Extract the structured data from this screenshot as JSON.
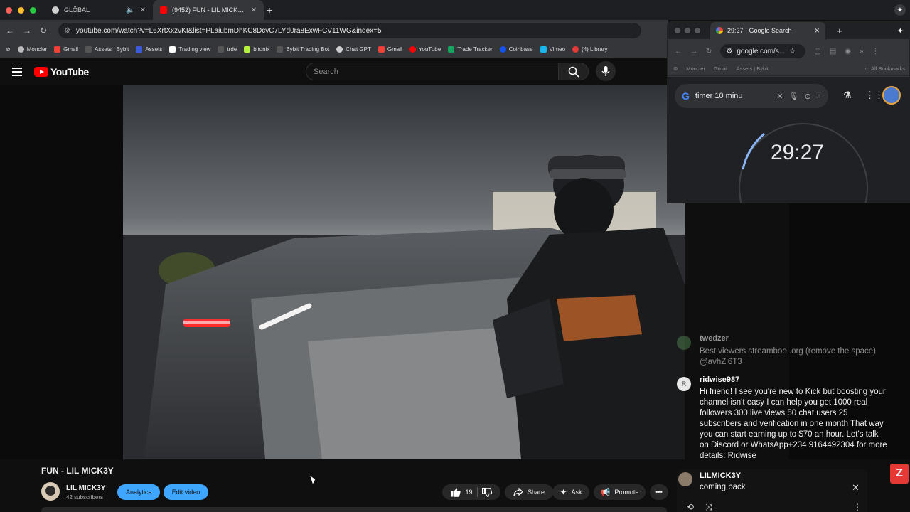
{
  "browser": {
    "tabs": [
      {
        "title": "GLÖBAL",
        "active": false
      },
      {
        "title": "(9452) FUN - LIL MICK3Y - Y",
        "active": true
      }
    ],
    "new_tab": "+",
    "url": "youtube.com/watch?v=L6XrtXxzvKI&list=PLaiubmDhKC8DcvC7LYd0ra8ExwFCV11WG&index=5",
    "bookmarks": [
      {
        "label": "Moncler",
        "color": "#bbbbbb"
      },
      {
        "label": "Gmail",
        "color": "#ea4335"
      },
      {
        "label": "Assets | Bybit",
        "color": "#555555"
      },
      {
        "label": "Assets",
        "color": "#3b5bdb"
      },
      {
        "label": "Trading view",
        "color": "#ffffff"
      },
      {
        "label": "trde",
        "color": "#555555"
      },
      {
        "label": "bitunix",
        "color": "#b5f23c"
      },
      {
        "label": "Bybit Trading Bot",
        "color": "#555555"
      },
      {
        "label": "Chat GPT",
        "color": "#cccccc"
      },
      {
        "label": "Gmail",
        "color": "#ea4335"
      },
      {
        "label": "YouTube",
        "color": "#ff0000"
      },
      {
        "label": "Trade Tracker",
        "color": "#1aa260"
      },
      {
        "label": "Coinbase",
        "color": "#1652f0"
      },
      {
        "label": "Vimeo",
        "color": "#1ab7ea"
      },
      {
        "label": "(4) Library",
        "color": "#e53935"
      }
    ]
  },
  "youtube": {
    "logo_text": "YouTube",
    "search_placeholder": "Search",
    "video_title": "FUN - LIL MICK3Y",
    "channel_name": "LIL MICK3Y",
    "subscribers": "42 subscribers",
    "analytics_label": "Analytics",
    "edit_video_label": "Edit video",
    "like_count": "19",
    "share_label": "Share",
    "ask_label": "Ask",
    "promote_label": "Promote",
    "more_label": "•••"
  },
  "google_window": {
    "tab_title": "29:27 - Google Search",
    "url": "google.com/s...",
    "bookmarks": [
      "Moncler",
      "Gmail",
      "Assets | Bybit"
    ],
    "all_bookmarks": "All Bookmarks",
    "search_query": "timer 10 minu",
    "timer": "29:27"
  },
  "chat": {
    "messages": [
      {
        "user": "twedzer",
        "text": "Best viewers streamboo .org (remove the space) @avhZi6T3",
        "avatar_color": "#4a7a4a",
        "faded": true
      },
      {
        "user": "ridwise987",
        "text": "Hi friend! I see you're new to Kick but boosting your channel isn't easy I can help you get 1000 real followers 300 live views 50 chat users 25 subscribers and verification in one month That way you can start earning up to $70 an hour. Let's talk on Discord or WhatsApp+234 9164492304 for more details: Ridwise",
        "avatar_color": "#e8e8e8",
        "avatar_letter": "R",
        "faded": false
      },
      {
        "user": "LILMICK3Y",
        "text": "coming back",
        "avatar_color": "#8a7a6a",
        "faded": false
      }
    ]
  },
  "badge": "Z"
}
